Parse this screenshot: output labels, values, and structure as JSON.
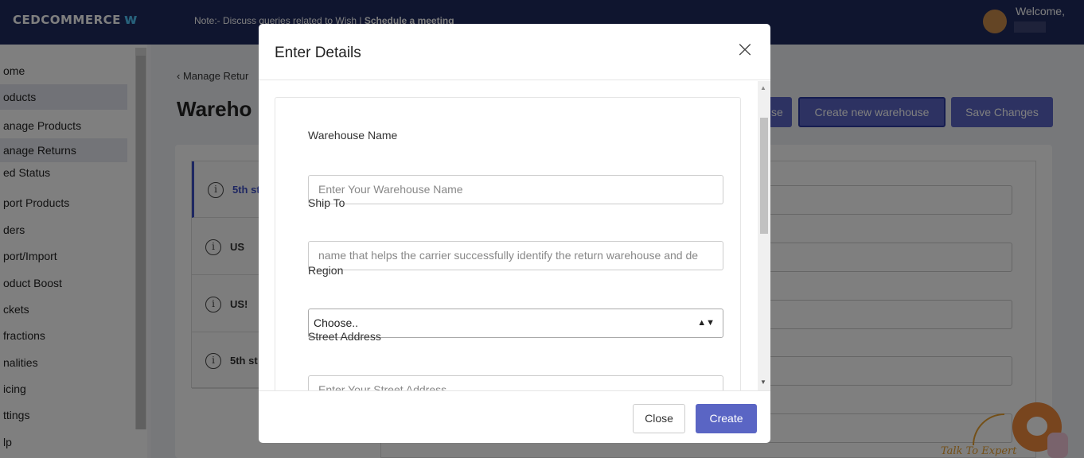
{
  "header": {
    "logo_text": "CEDCOMMERCE",
    "logo_mark": "w",
    "note_prefix": "Note:- Discuss queries related to Wish | ",
    "note_link": "Schedule a meeting",
    "welcome": "Welcome,"
  },
  "sidebar": {
    "items": [
      {
        "label": "ome"
      },
      {
        "label": "oducts"
      },
      {
        "label": "anage Products"
      },
      {
        "label": "anage Returns"
      },
      {
        "label": "ed Status"
      },
      {
        "label": "port Products"
      },
      {
        "label": "ders"
      },
      {
        "label": "port/Import"
      },
      {
        "label": "oduct Boost"
      },
      {
        "label": "ckets"
      },
      {
        "label": "fractions"
      },
      {
        "label": "nalities"
      },
      {
        "label": "icing"
      },
      {
        "label": "ttings"
      },
      {
        "label": "lp"
      }
    ]
  },
  "main": {
    "breadcrumb": "Manage Retur",
    "back_icon": "chevron-left-icon",
    "title": "Wareho",
    "buttons": {
      "partial_label": "se",
      "create_warehouse": "Create new warehouse",
      "save_changes": "Save Changes"
    },
    "warehouses": [
      {
        "label": "5th st",
        "active": true
      },
      {
        "label": "US",
        "active": false
      },
      {
        "label": "US!",
        "active": false
      },
      {
        "label": "5th st",
        "active": false
      }
    ],
    "info_glyph": "i"
  },
  "modal": {
    "title": "Enter Details",
    "close_glyph": "×",
    "fields": {
      "warehouse_name_label": "Warehouse Name",
      "warehouse_name_placeholder": "Enter Your Warehouse Name",
      "ship_to_label": "Ship To",
      "ship_to_placeholder": "name that helps the carrier successfully identify the return warehouse and de",
      "region_label": "Region",
      "region_value": "Choose..",
      "street_label": "Street Address",
      "street_placeholder": "Enter Your Street Address"
    },
    "footer": {
      "close_label": "Close",
      "create_label": "Create"
    }
  },
  "chat": {
    "talk_label": "Talk To Expert"
  },
  "colors": {
    "header_bg": "#1f2a5e",
    "primary_button": "#5a65c4",
    "chat_orange": "#f08a3c"
  }
}
